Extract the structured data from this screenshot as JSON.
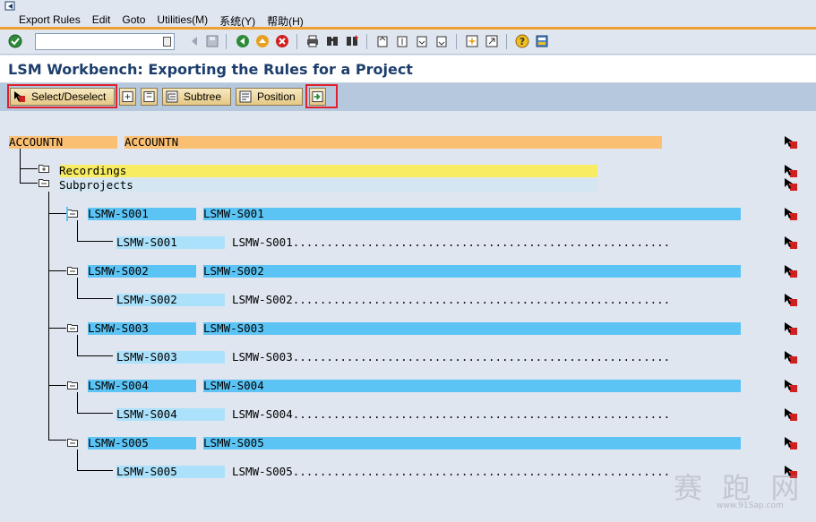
{
  "menu": {
    "items": [
      "Export Rules",
      "Edit",
      "Goto",
      "Utilities(M)",
      "系统(Y)",
      "帮助(H)"
    ]
  },
  "toolbar": {
    "command_value": ""
  },
  "title": "LSM Workbench: Exporting the Rules for a Project",
  "app_toolbar": {
    "select_deselect": "Select/Deselect",
    "subtree": "Subtree",
    "position": "Position"
  },
  "tree": {
    "root": {
      "code": "ACCOUNTN",
      "name": "ACCOUNTN"
    },
    "recordings": "Recordings",
    "subprojects": "Subprojects",
    "items": [
      {
        "code": "LSMW-S001",
        "name": "LSMW-S001",
        "child_code": "LSMW-S001",
        "child_name": "LSMW-S001........................................................"
      },
      {
        "code": "LSMW-S002",
        "name": "LSMW-S002",
        "child_code": "LSMW-S002",
        "child_name": "LSMW-S002........................................................"
      },
      {
        "code": "LSMW-S003",
        "name": "LSMW-S003",
        "child_code": "LSMW-S003",
        "child_name": "LSMW-S003........................................................"
      },
      {
        "code": "LSMW-S004",
        "name": "LSMW-S004",
        "child_code": "LSMW-S004",
        "child_name": "LSMW-S004........................................................"
      },
      {
        "code": "LSMW-S005",
        "name": "LSMW-S005",
        "child_code": "LSMW-S005",
        "child_name": "LSMW-S005........................................................"
      }
    ]
  },
  "watermark": {
    "text": "赛 跑 网",
    "url": "www.91Sap.com"
  },
  "colors": {
    "accent_orange": "#f0a030",
    "root_orange": "#fbbf72",
    "recording_yellow": "#f8ec62",
    "node_blue": "#5bc4f5",
    "child_blue": "#ace1fb",
    "highlight_red": "#e0202a"
  }
}
